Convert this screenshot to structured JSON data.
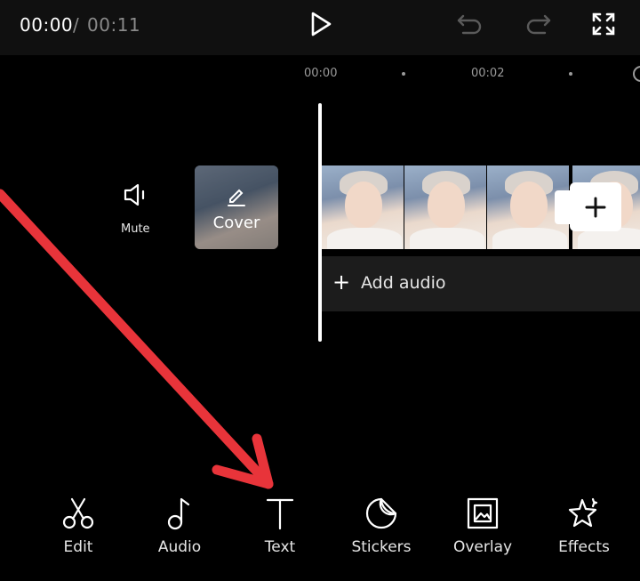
{
  "player": {
    "current_time": "00:00",
    "separator": "/",
    "total_time": "00:11"
  },
  "ruler": {
    "mark_1": "00:00",
    "mark_2": "00:02"
  },
  "track": {
    "mute_label": "Mute",
    "cover_label": "Cover",
    "add_audio_label": "Add audio",
    "add_audio_symbol": "+"
  },
  "toolbar": {
    "items": [
      {
        "label": "Edit",
        "icon": "scissors-icon"
      },
      {
        "label": "Audio",
        "icon": "music-note-icon"
      },
      {
        "label": "Text",
        "icon": "text-icon"
      },
      {
        "label": "Stickers",
        "icon": "sticker-icon"
      },
      {
        "label": "Overlay",
        "icon": "overlay-icon"
      },
      {
        "label": "Effects",
        "icon": "effects-star-icon"
      }
    ]
  },
  "colors": {
    "background": "#000000",
    "top_bar": "#101010",
    "arrow": "#e8343a",
    "muted_text": "#8a8a8a"
  }
}
